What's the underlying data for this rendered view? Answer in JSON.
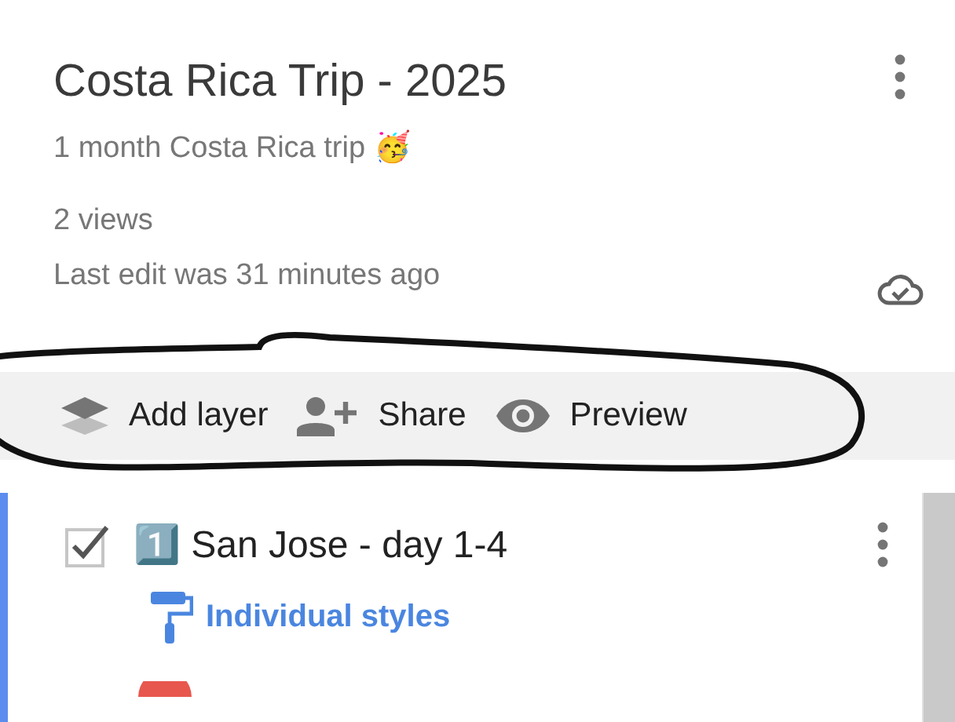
{
  "map": {
    "title": "Costa Rica Trip - 2025",
    "description": "1 month Costa Rica trip 🥳",
    "views": "2 views",
    "last_edit": "Last edit was 31 minutes ago"
  },
  "toolbar": [
    {
      "kind": "layers",
      "label": "Add layer"
    },
    {
      "kind": "share",
      "label": "Share"
    },
    {
      "kind": "preview",
      "label": "Preview"
    }
  ],
  "layers": [
    {
      "checked": true,
      "selected": true,
      "title": "1️⃣ San Jose - day 1-4",
      "style_label": "Individual styles"
    }
  ]
}
